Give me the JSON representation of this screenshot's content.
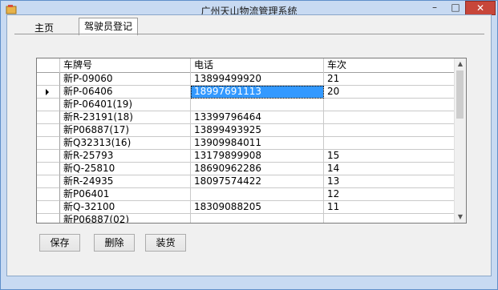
{
  "window": {
    "title": "广州天山物流管理系统",
    "minimize_glyph": "–",
    "maximize_glyph": "□",
    "close_glyph": "✕"
  },
  "tabs": [
    {
      "label": "主页",
      "active": false
    },
    {
      "label": "驾驶员登记",
      "active": true
    }
  ],
  "grid": {
    "columns": [
      "车牌号",
      "电话",
      "车次"
    ],
    "rows": [
      [
        "新P-09060",
        "13899499920",
        "21"
      ],
      [
        "新P-06406",
        "18997691113",
        "20"
      ],
      [
        "新P-06401(19)",
        "",
        ""
      ],
      [
        "新R-23191(18)",
        "13399796464",
        ""
      ],
      [
        "新P06887(17)",
        "13899493925",
        ""
      ],
      [
        "新Q32313(16)",
        "13909984011",
        ""
      ],
      [
        "新R-25793",
        "13179899908",
        "15"
      ],
      [
        "新Q-25810",
        "18690962286",
        "14"
      ],
      [
        "新R-24935",
        "18097574422",
        "13"
      ],
      [
        "新P06401",
        "",
        "12"
      ],
      [
        "新Q-32100",
        "18309088205",
        "11"
      ],
      [
        "新P06887(02)",
        "",
        ""
      ]
    ],
    "current_row": 1,
    "selected_cell": {
      "row": 1,
      "col": 1
    }
  },
  "buttons": {
    "save": "保存",
    "delete": "删除",
    "load": "装货"
  }
}
